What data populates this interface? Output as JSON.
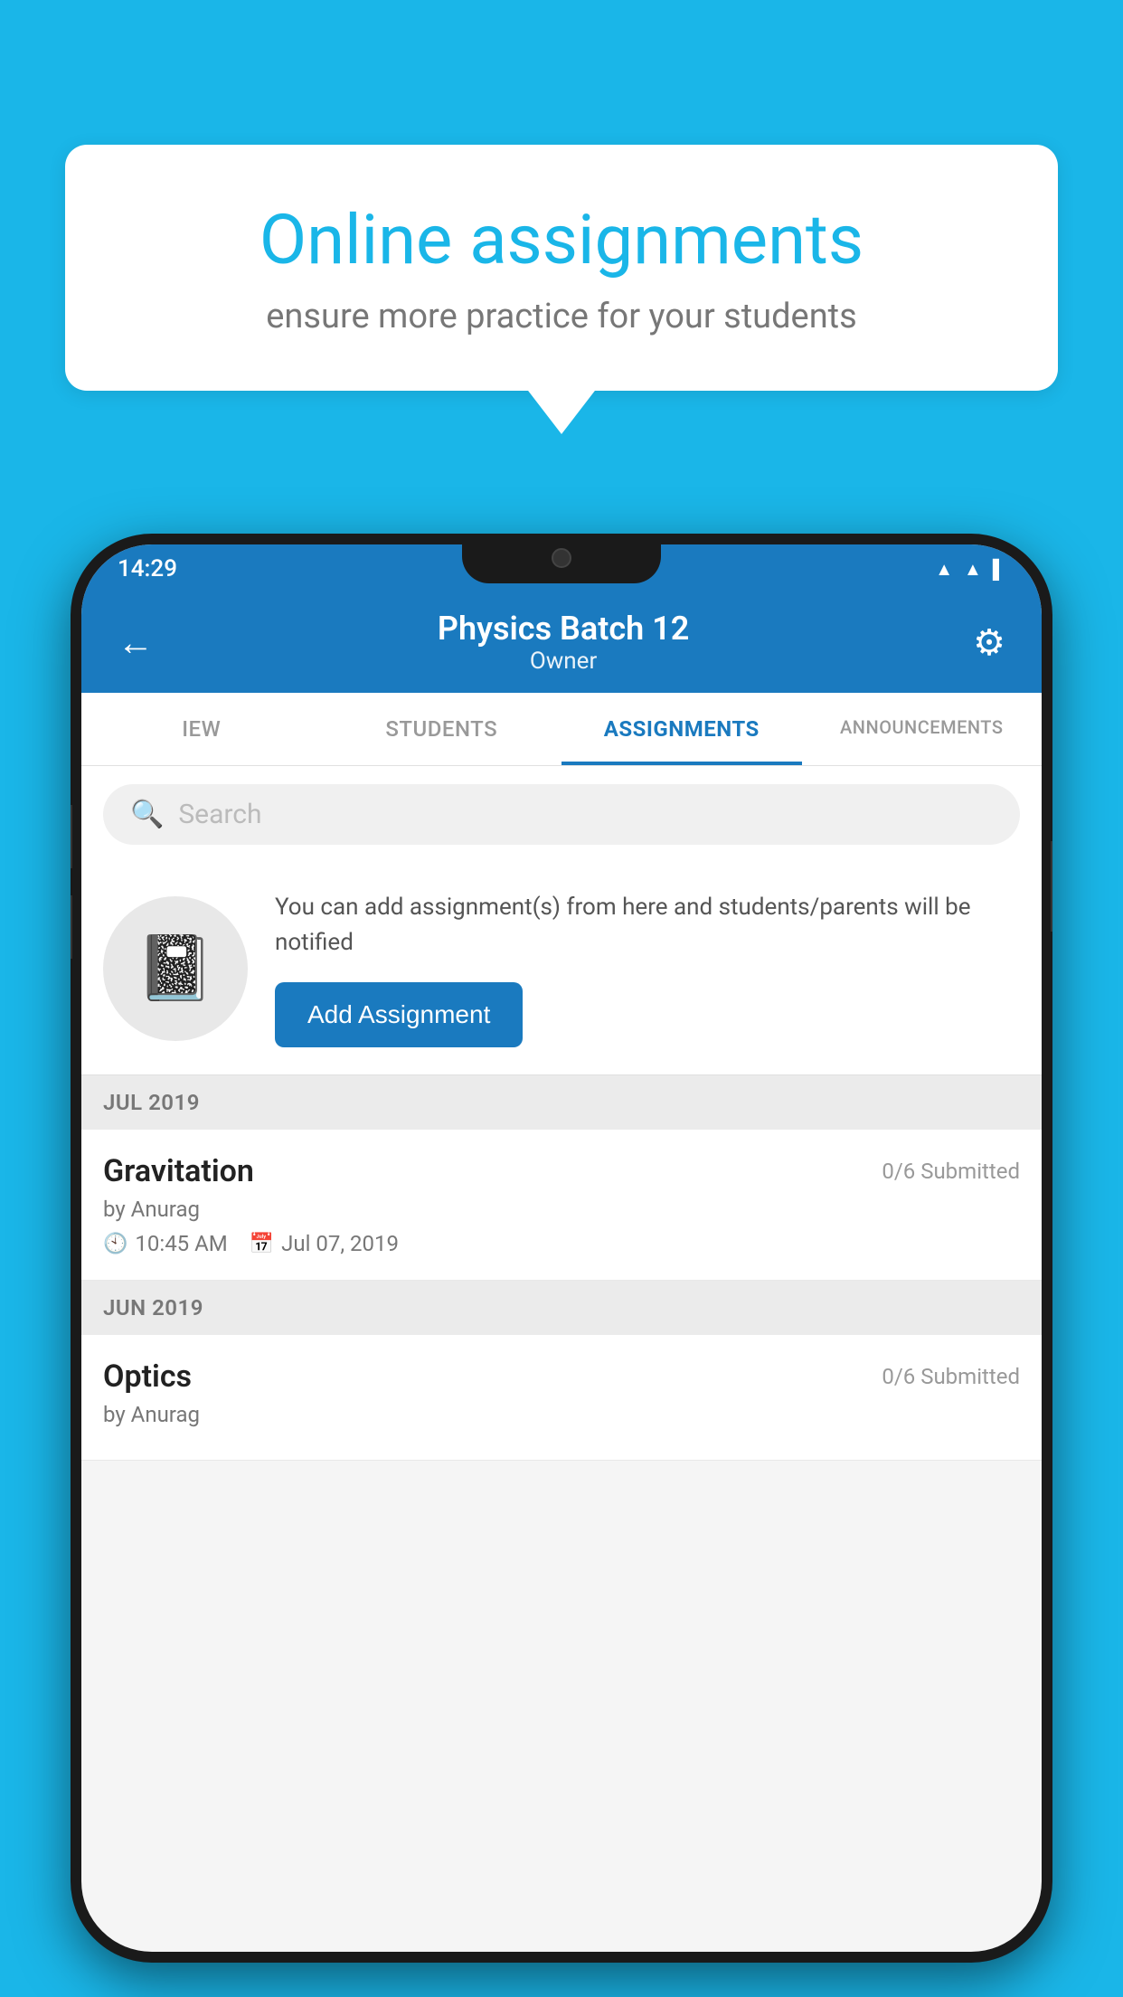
{
  "background_color": "#1ab6e8",
  "speech_bubble": {
    "title": "Online assignments",
    "subtitle": "ensure more practice for your students"
  },
  "phone": {
    "status_bar": {
      "time": "14:29",
      "icons": [
        "wifi",
        "signal",
        "battery"
      ]
    },
    "header": {
      "title": "Physics Batch 12",
      "subtitle": "Owner",
      "back_label": "←",
      "settings_label": "⚙"
    },
    "tabs": [
      {
        "label": "IEW",
        "active": false
      },
      {
        "label": "STUDENTS",
        "active": false
      },
      {
        "label": "ASSIGNMENTS",
        "active": true
      },
      {
        "label": "ANNOUNCEMENTS",
        "active": false
      }
    ],
    "search": {
      "placeholder": "Search"
    },
    "promo": {
      "description": "You can add assignment(s) from here and students/parents will be notified",
      "button_label": "Add Assignment"
    },
    "sections": [
      {
        "header": "JUL 2019",
        "assignments": [
          {
            "name": "Gravitation",
            "submitted": "0/6 Submitted",
            "by": "by Anurag",
            "time": "10:45 AM",
            "date": "Jul 07, 2019"
          }
        ]
      },
      {
        "header": "JUN 2019",
        "assignments": [
          {
            "name": "Optics",
            "submitted": "0/6 Submitted",
            "by": "by Anurag",
            "time": "",
            "date": ""
          }
        ]
      }
    ]
  }
}
